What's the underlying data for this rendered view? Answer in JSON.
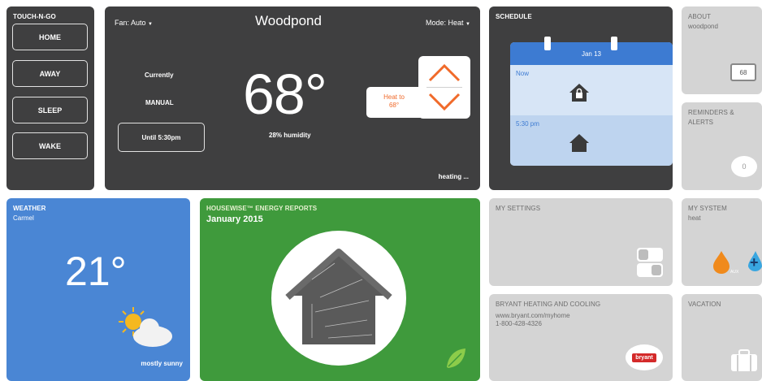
{
  "touch_n_go": {
    "title": "TOUCH-N-GO",
    "buttons": [
      "HOME",
      "AWAY",
      "SLEEP",
      "WAKE"
    ]
  },
  "thermostat": {
    "name": "Woodpond",
    "fan_label": "Fan: Auto",
    "mode_label": "Mode: Heat",
    "currently_label": "Currently",
    "manual_label": "MANUAL",
    "until_label": "Until 5:30pm",
    "temperature": "68°",
    "humidity": "28% humidity",
    "heat_to_label": "Heat to",
    "heat_to_value": "68°",
    "status": "heating ..."
  },
  "schedule": {
    "title": "SCHEDULE",
    "date": "Jan 13",
    "rows": [
      {
        "time": "Now",
        "icon": "home-away-icon"
      },
      {
        "time": "5:30 pm",
        "icon": "home-icon"
      }
    ]
  },
  "about": {
    "title": "ABOUT",
    "subtitle": "woodpond",
    "badge": "68"
  },
  "reminders": {
    "title_line1": "REMINDERS &",
    "title_line2": "ALERTS",
    "count": "0"
  },
  "weather": {
    "title": "WEATHER",
    "location": "Carmel",
    "temperature": "21°",
    "condition": "mostly sunny"
  },
  "energy": {
    "title": "HOUSEWISE™ ENERGY REPORTS",
    "subtitle": "January 2015"
  },
  "my_settings": {
    "title": "MY SETTINGS"
  },
  "bryant": {
    "title": "BRYANT HEATING AND COOLING",
    "url": "www.bryant.com/myhome",
    "phone": "1-800-428-4326",
    "logo": "bryant"
  },
  "my_system": {
    "title": "MY SYSTEM",
    "subtitle": "heat",
    "aux_label": "AUX"
  },
  "vacation": {
    "title": "VACATION"
  },
  "colors": {
    "dark_tile": "#3f3f40",
    "light_tile": "#d4d4d4",
    "weather_blue": "#4a86d4",
    "energy_green": "#3f9a3c",
    "heat_orange": "#f06a2a",
    "calendar_blue": "#3d7bd2"
  }
}
